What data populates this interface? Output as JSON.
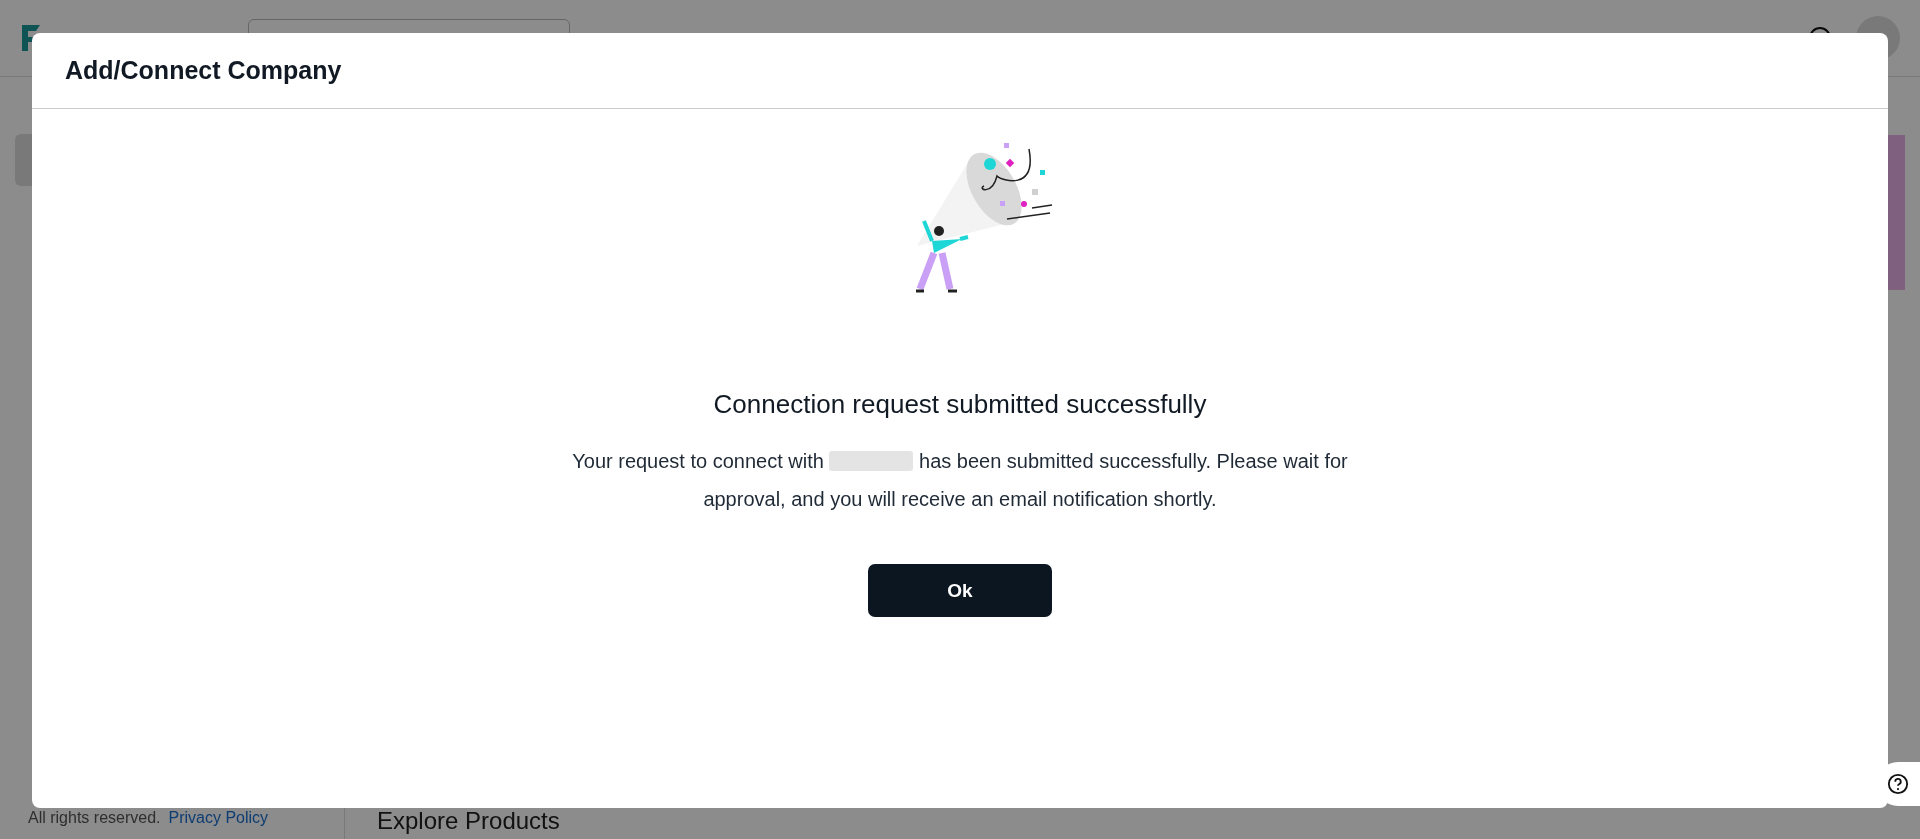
{
  "page": {
    "main": {
      "section_title": "Explore Products"
    },
    "footer": {
      "rights": "All rights reserved.",
      "privacy_link": "Privacy Policy"
    }
  },
  "dialog": {
    "title": "Add/Connect Company",
    "heading": "Connection request submitted successfully",
    "message": {
      "before": "Your request to connect with",
      "after": "has been submitted successfully. Please wait for approval, and you will receive an email notification shortly."
    },
    "ok_button": "Ok"
  }
}
